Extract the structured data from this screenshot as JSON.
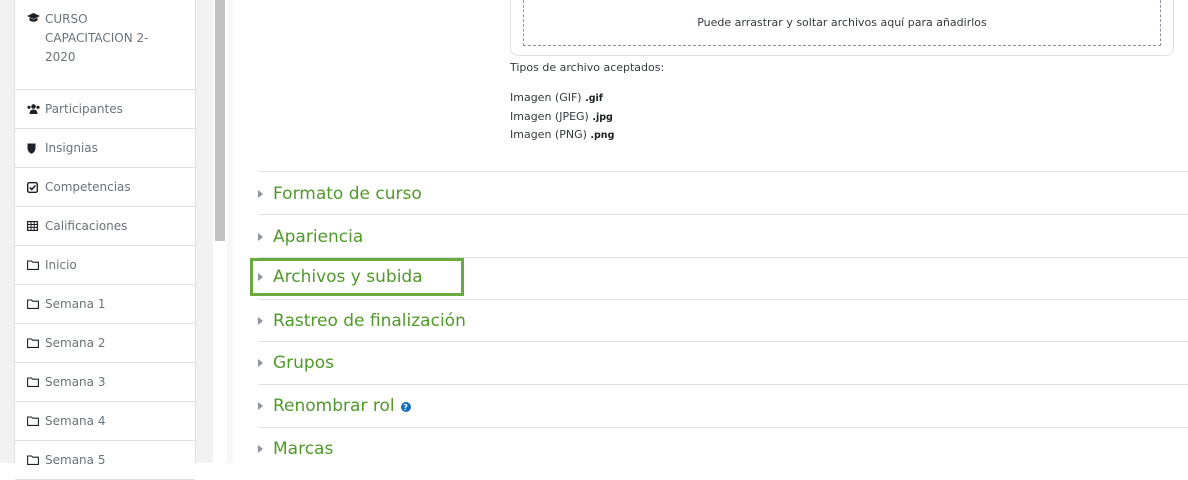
{
  "sidebar": {
    "course": {
      "icon": "graduation-cap-icon",
      "label": "CURSO CAPACITACION 2-2020"
    },
    "items": [
      {
        "icon": "users-icon",
        "label": "Participantes"
      },
      {
        "icon": "shield-icon",
        "label": "Insignias"
      },
      {
        "icon": "check-square-icon",
        "label": "Competencias"
      },
      {
        "icon": "table-icon",
        "label": "Calificaciones"
      },
      {
        "icon": "folder-icon",
        "label": "Inicio"
      },
      {
        "icon": "folder-icon",
        "label": "Semana 1"
      },
      {
        "icon": "folder-icon",
        "label": "Semana 2"
      },
      {
        "icon": "folder-icon",
        "label": "Semana 3"
      },
      {
        "icon": "folder-icon",
        "label": "Semana 4"
      },
      {
        "icon": "folder-icon",
        "label": "Semana 5"
      }
    ]
  },
  "file_picker": {
    "dropzone_text": "Puede arrastrar y soltar archivos aquí para añadirlos",
    "accepted_label": "Tipos de archivo aceptados:",
    "types": [
      {
        "name": "Imagen (GIF)",
        "ext": ".gif"
      },
      {
        "name": "Imagen (JPEG)",
        "ext": ".jpg"
      },
      {
        "name": "Imagen (PNG)",
        "ext": ".png"
      }
    ]
  },
  "sections": [
    {
      "label": "Formato de curso"
    },
    {
      "label": "Apariencia"
    },
    {
      "label": "Archivos y subida",
      "highlighted": true
    },
    {
      "label": "Rastreo de finalización"
    },
    {
      "label": "Grupos"
    },
    {
      "label": "Renombrar rol",
      "help_icon": "question-circle-icon"
    },
    {
      "label": "Marcas"
    }
  ],
  "colors": {
    "section_link": "#4f9a2a",
    "highlight_border": "#6aab3e",
    "help_icon": "#0f6cbf"
  }
}
